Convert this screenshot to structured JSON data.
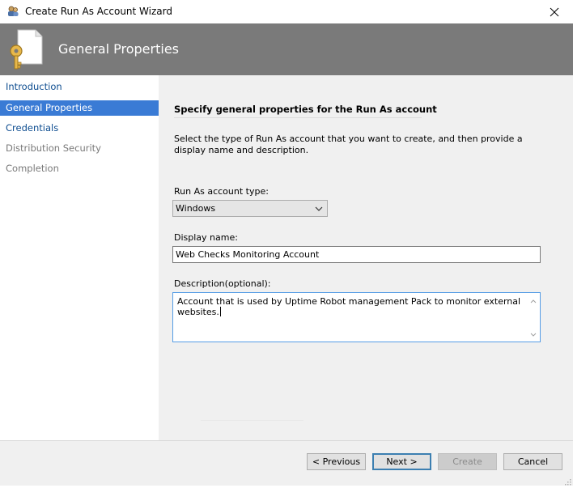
{
  "window": {
    "title": "Create Run As Account Wizard",
    "icons": {
      "app": "run-as-account-icon",
      "close": "close-icon"
    }
  },
  "banner": {
    "title": "General Properties",
    "icon": "key-document-icon",
    "background": "#7a7a7a"
  },
  "nav": {
    "items": [
      {
        "label": "Introduction",
        "state": "link"
      },
      {
        "label": "General Properties",
        "state": "active"
      },
      {
        "label": "Credentials",
        "state": "link"
      },
      {
        "label": "Distribution Security",
        "state": "disabled"
      },
      {
        "label": "Completion",
        "state": "disabled"
      }
    ],
    "active_color": "#3a7bd5",
    "link_color": "#0e4d90"
  },
  "content": {
    "heading": "Specify general properties for the Run As account",
    "instructions": "Select the type of Run As account that you want to create, and then provide a display name and description.",
    "account_type": {
      "label": "Run As account type:",
      "selected": "Windows"
    },
    "display_name": {
      "label": "Display name:",
      "value": "Web Checks Monitoring Account"
    },
    "description": {
      "label": "Description(optional):",
      "value": "Account that is used by Uptime Robot management Pack to monitor external websites."
    }
  },
  "footer": {
    "previous": "< Previous",
    "next": "Next >",
    "create": "Create",
    "cancel": "Cancel"
  }
}
